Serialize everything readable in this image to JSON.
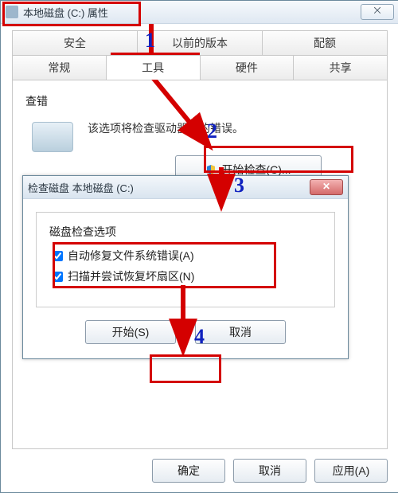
{
  "window": {
    "title": "本地磁盘 (C:) 属性",
    "close_glyph": "⨉"
  },
  "tabs_row1": {
    "security": "安全",
    "prev": "以前的版本",
    "quota": "配额"
  },
  "tabs_row2": {
    "general": "常规",
    "tools": "工具",
    "hardware": "硬件",
    "share": "共享"
  },
  "group": {
    "title": "查错",
    "desc": "该选项将检查驱动器中的错误。",
    "check_btn": "开始检查(C)..."
  },
  "dialog": {
    "title": "检查磁盘 本地磁盘 (C:)",
    "close_glyph": "✕",
    "section": "磁盘检查选项",
    "opt1": "自动修复文件系统错误(A)",
    "opt2": "扫描并尝试恢复坏扇区(N)",
    "start": "开始(S)",
    "cancel": "取消"
  },
  "footer": {
    "ok": "确定",
    "cancel": "取消",
    "apply": "应用(A)"
  },
  "annotations": {
    "n1": "1",
    "n2": "2",
    "n3": "3",
    "n4": "4"
  }
}
